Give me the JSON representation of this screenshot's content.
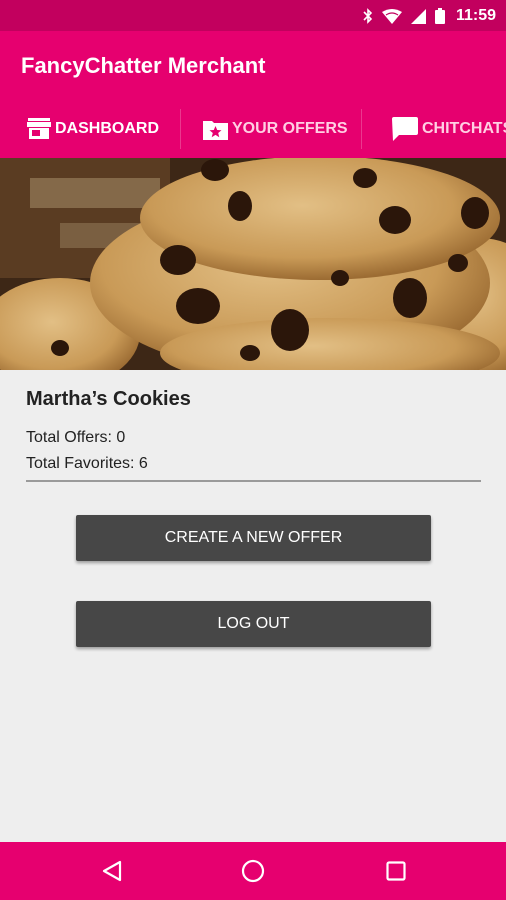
{
  "status_bar": {
    "time": "11:59",
    "icons": [
      "bluetooth-icon",
      "wifi-icon",
      "cell-signal-icon",
      "battery-icon"
    ]
  },
  "app": {
    "title": "FancyChatter Merchant"
  },
  "tabs": [
    {
      "label": "DASHBOARD",
      "icon": "storefront-icon",
      "selected": true
    },
    {
      "label": "YOUR OFFERS",
      "icon": "star-folder-icon",
      "selected": false
    },
    {
      "label": "CHITCHATS",
      "icon": "chat-bubble-icon",
      "selected": false
    }
  ],
  "store": {
    "name": "Martha’s Cookies",
    "total_offers": "Total Offers: 0",
    "total_favorites": "Total Favorites: 6"
  },
  "actions": {
    "create_offer": "CREATE A NEW OFFER",
    "logout": "LOG OUT"
  },
  "nav": {
    "icons": [
      "back-icon",
      "home-icon",
      "recents-icon"
    ]
  },
  "colors": {
    "primary": "#e6006f",
    "status_bar": "#c2005e",
    "button": "#474747",
    "background": "#eeeeee"
  }
}
